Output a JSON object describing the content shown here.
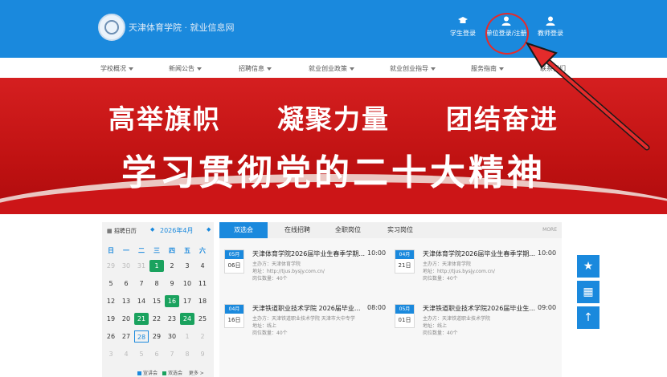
{
  "header": {
    "site_title": "天津体育学院 · 就业信息网",
    "login_buttons": [
      {
        "label": "学生登录",
        "icon": "graduation-cap-icon"
      },
      {
        "label": "单位登录/注册",
        "icon": "user-icon"
      },
      {
        "label": "教师登录",
        "icon": "user-icon"
      }
    ]
  },
  "nav": {
    "items": [
      "学校概况",
      "新闻公告",
      "招聘信息",
      "就业创业政策",
      "就业创业指导",
      "服务指南",
      "联系我们"
    ]
  },
  "banner": {
    "slogan_line1": "高举旗帜　　凝聚力量　　团结奋进",
    "slogan_line2": "学习贯彻党的二十大精神"
  },
  "calendar": {
    "title": "招聘日历",
    "month": "2026年4月",
    "weekdays": [
      "日",
      "一",
      "二",
      "三",
      "四",
      "五",
      "六"
    ],
    "days": [
      {
        "d": "29",
        "dim": true
      },
      {
        "d": "30",
        "dim": true
      },
      {
        "d": "31",
        "dim": true
      },
      {
        "d": "1",
        "green": true
      },
      {
        "d": "2"
      },
      {
        "d": "3"
      },
      {
        "d": "4"
      },
      {
        "d": "5"
      },
      {
        "d": "6"
      },
      {
        "d": "7"
      },
      {
        "d": "8"
      },
      {
        "d": "9"
      },
      {
        "d": "10"
      },
      {
        "d": "11"
      },
      {
        "d": "12"
      },
      {
        "d": "13"
      },
      {
        "d": "14"
      },
      {
        "d": "15"
      },
      {
        "d": "16",
        "green": true
      },
      {
        "d": "17"
      },
      {
        "d": "18"
      },
      {
        "d": "19"
      },
      {
        "d": "20"
      },
      {
        "d": "21",
        "green": true
      },
      {
        "d": "22"
      },
      {
        "d": "23"
      },
      {
        "d": "24",
        "green": true
      },
      {
        "d": "25"
      },
      {
        "d": "26"
      },
      {
        "d": "27"
      },
      {
        "d": "28",
        "today": true
      },
      {
        "d": "29"
      },
      {
        "d": "30"
      },
      {
        "d": "1",
        "dim": true
      },
      {
        "d": "2",
        "dim": true
      },
      {
        "d": "3",
        "dim": true
      },
      {
        "d": "4",
        "dim": true
      },
      {
        "d": "5",
        "dim": true
      },
      {
        "d": "6",
        "dim": true
      },
      {
        "d": "7",
        "dim": true
      },
      {
        "d": "8",
        "dim": true
      },
      {
        "d": "9",
        "dim": true
      }
    ],
    "legend": [
      {
        "label": "宣讲会",
        "color": "#1a89dd"
      },
      {
        "label": "双选会",
        "color": "#1aa25e"
      }
    ],
    "more": "更多 >"
  },
  "events": {
    "tabs": [
      "双选会",
      "在线招聘",
      "全职岗位",
      "实习岗位"
    ],
    "active_tab": 0,
    "more": "MORE",
    "items": [
      {
        "month": "05月",
        "day": "06日",
        "title": "天津体育学院2026届毕业生春季学期...",
        "time": "10:00",
        "host": "主办方：天津体育学院",
        "addr": "地址：http://tjus.bysjy.com.cn/",
        "jobs": "岗位数量：40个"
      },
      {
        "month": "04月",
        "day": "21日",
        "title": "天津体育学院2026届毕业生春季学期...",
        "time": "10:00",
        "host": "主办方：天津体育学院",
        "addr": "地址：http://tjus.bysjy.com.cn/",
        "jobs": "岗位数量：40个"
      },
      {
        "month": "04月",
        "day": "16日",
        "title": "天津铁道职业技术学院 2026届毕业...",
        "time": "08:00",
        "host": "主办方：天津铁道职业技术学院 天津市大中专学",
        "addr": "地址：线上",
        "jobs": "岗位数量：40个"
      },
      {
        "month": "05月",
        "day": "01日",
        "title": "天津铁道职业技术学院2026届毕业生...",
        "time": "09:00",
        "host": "主办方：天津铁道职业技术学院",
        "addr": "地址：线上",
        "jobs": "岗位数量：40个"
      }
    ]
  },
  "side_buttons": [
    {
      "icon": "star-icon",
      "glyph": "★"
    },
    {
      "icon": "qrcode-icon",
      "glyph": "▦"
    },
    {
      "icon": "arrow-up-icon",
      "glyph": "↑"
    }
  ],
  "colors": {
    "primary": "#1a89dd",
    "banner_red": "#c8161a",
    "calendar_green": "#1aa25e",
    "annotation_red": "#e42b2b"
  }
}
